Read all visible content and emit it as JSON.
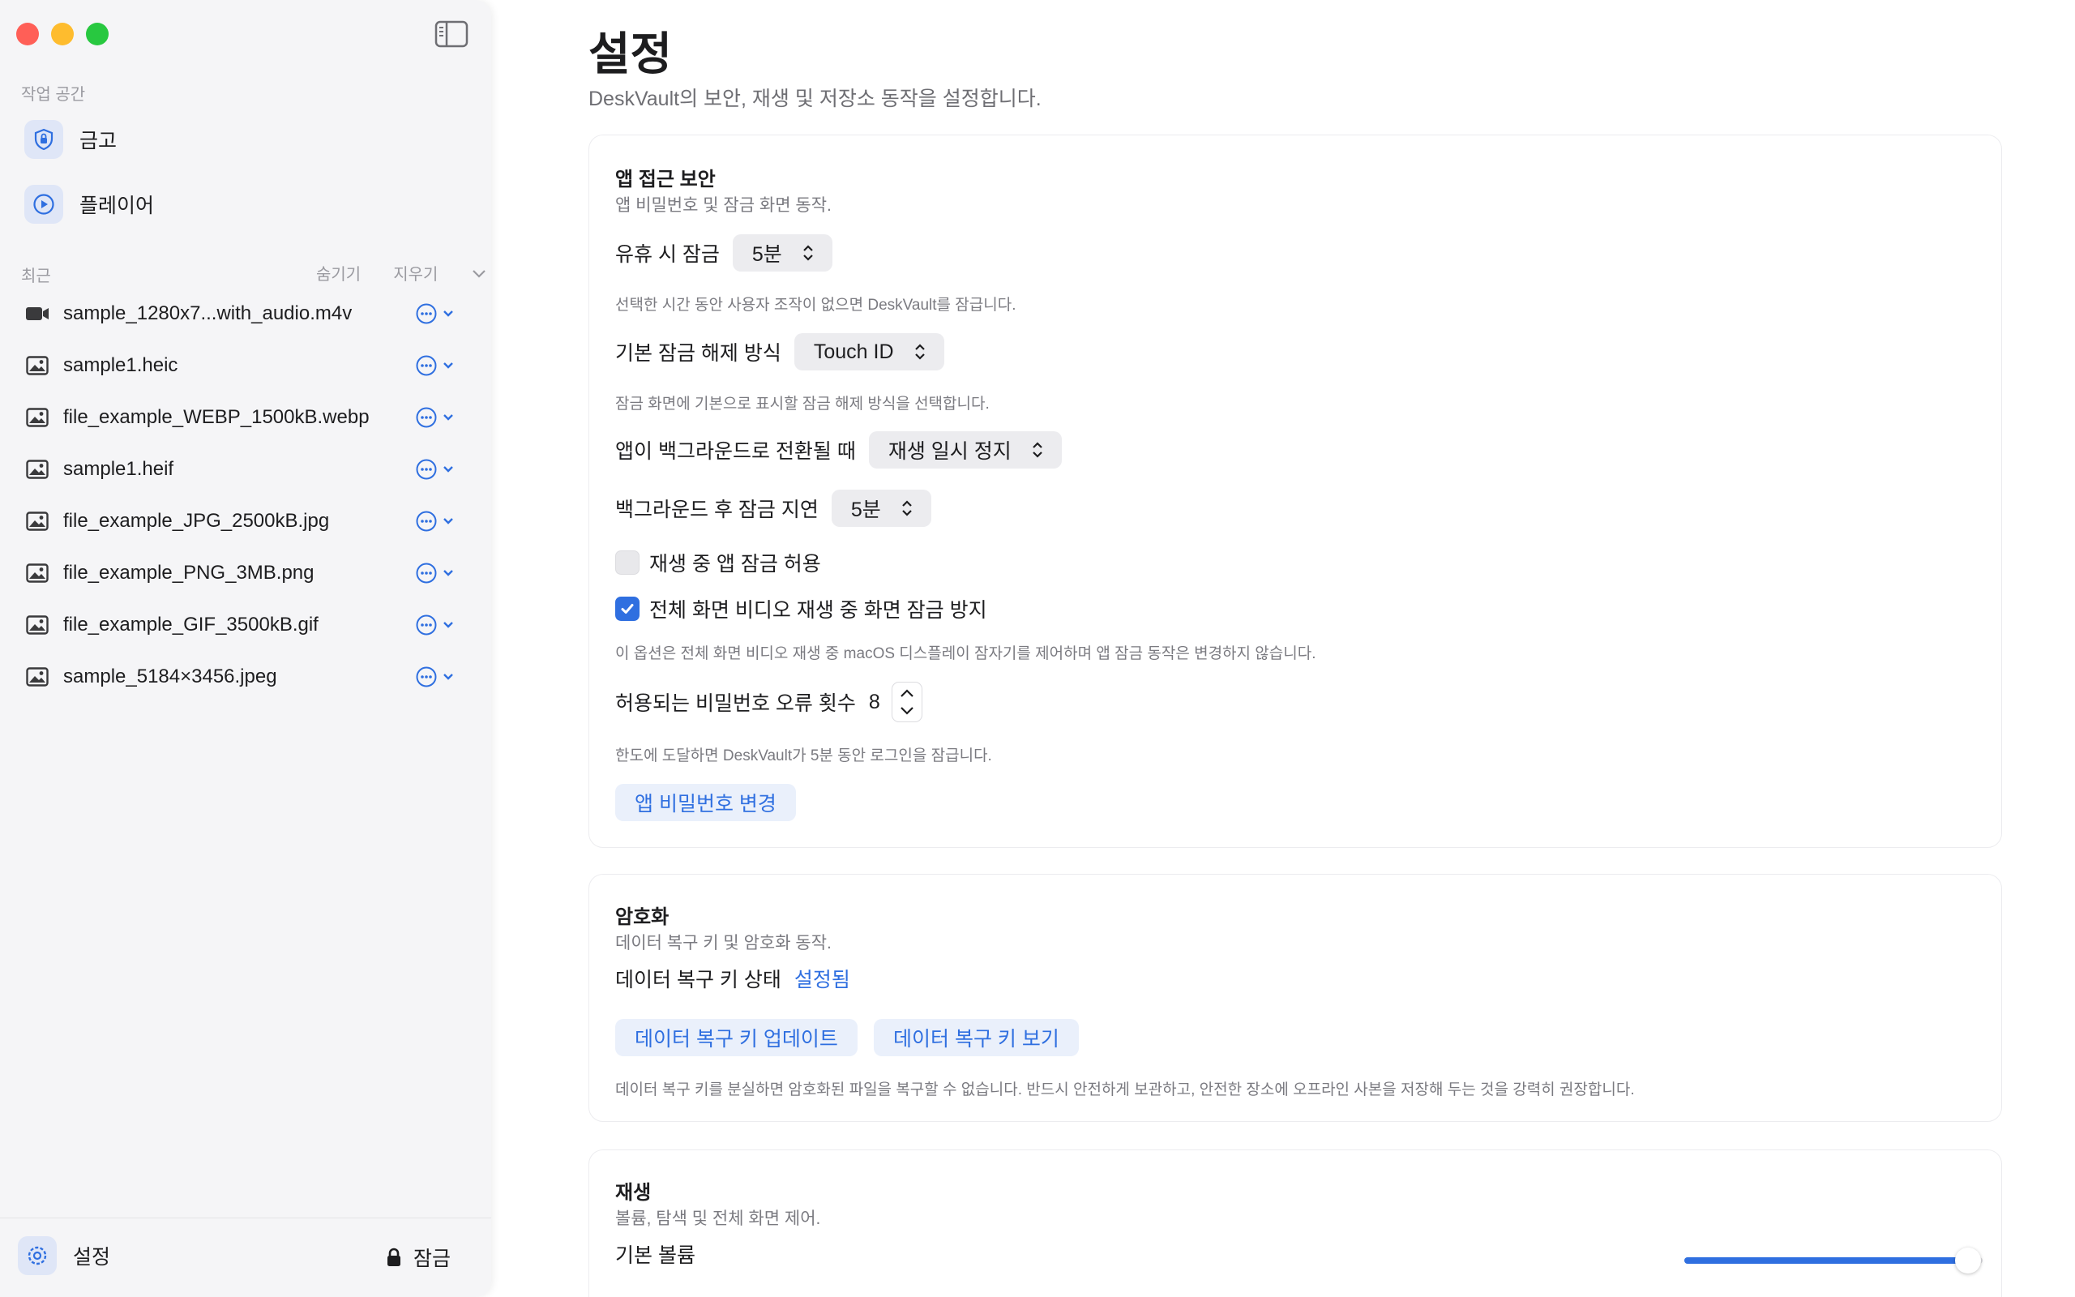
{
  "sidebar": {
    "workspace_label": "작업 공간",
    "workspace_items": [
      {
        "label": "금고",
        "icon": "shield-icon"
      },
      {
        "label": "플레이어",
        "icon": "play-icon"
      }
    ],
    "recent_label": "최근",
    "recent_hide": "숨기기",
    "recent_clear": "지우기",
    "recent_files": [
      {
        "name": "sample_1280x7...with_audio.m4v",
        "icon": "video-icon"
      },
      {
        "name": "sample1.heic",
        "icon": "image-icon"
      },
      {
        "name": "file_example_WEBP_1500kB.webp",
        "icon": "image-icon"
      },
      {
        "name": "sample1.heif",
        "icon": "image-icon"
      },
      {
        "name": "file_example_JPG_2500kB.jpg",
        "icon": "image-icon"
      },
      {
        "name": "file_example_PNG_3MB.png",
        "icon": "image-icon"
      },
      {
        "name": "file_example_GIF_3500kB.gif",
        "icon": "image-icon"
      },
      {
        "name": "sample_5184×3456.jpeg",
        "icon": "image-icon"
      }
    ],
    "settings_label": "설정",
    "lock_label": "잠금"
  },
  "main": {
    "title": "설정",
    "subtitle": "DeskVault의 보안, 재생 및 저장소 동작을 설정합니다.",
    "security": {
      "title": "앱 접근 보안",
      "desc": "앱 비밀번호 및 잠금 화면 동작.",
      "idle_lock_label": "유휴 시 잠금",
      "idle_lock_value": "5분",
      "idle_lock_hint": "선택한 시간 동안 사용자 조작이 없으면 DeskVault를 잠급니다.",
      "unlock_method_label": "기본 잠금 해제 방식",
      "unlock_method_value": "Touch ID",
      "unlock_method_hint": "잠금 화면에 기본으로 표시할 잠금 해제 방식을 선택합니다.",
      "background_label": "앱이 백그라운드로 전환될 때",
      "background_value": "재생 일시 정지",
      "bg_delay_label": "백그라운드 후 잠금 지연",
      "bg_delay_value": "5분",
      "allow_lock_playing_label": "재생 중 앱 잠금 허용",
      "allow_lock_playing_checked": false,
      "prevent_lock_label": "전체 화면 비디오 재생 중 화면 잠금 방지",
      "prevent_lock_checked": true,
      "prevent_lock_hint": "이 옵션은 전체 화면 비디오 재생 중 macOS 디스플레이 잠자기를 제어하며 앱 잠금 동작은 변경하지 않습니다.",
      "attempts_label": "허용되는 비밀번호 오류 횟수",
      "attempts_value": "8",
      "attempts_hint": "한도에 도달하면 DeskVault가 5분 동안 로그인을 잠급니다.",
      "change_password_button": "앱 비밀번호 변경"
    },
    "encryption": {
      "title": "암호화",
      "desc": "데이터 복구 키 및 암호화 동작.",
      "status_label": "데이터 복구 키 상태",
      "status_value": "설정됨",
      "update_button": "데이터 복구 키 업데이트",
      "view_button": "데이터 복구 키 보기",
      "hint": "데이터 복구 키를 분실하면 암호화된 파일을 복구할 수 없습니다. 반드시 안전하게 보관하고, 안전한 장소에 오프라인 사본을 저장해 두는 것을 강력히 권장합니다."
    },
    "playback": {
      "title": "재생",
      "desc": "볼륨, 탐색 및 전체 화면 제어.",
      "volume_label": "기본 볼륨",
      "volume_level": 0.95
    }
  },
  "colors": {
    "accent": "#2f6fe0",
    "close": "#ff5f57",
    "minimize": "#febc2e",
    "zoom": "#28c840"
  }
}
